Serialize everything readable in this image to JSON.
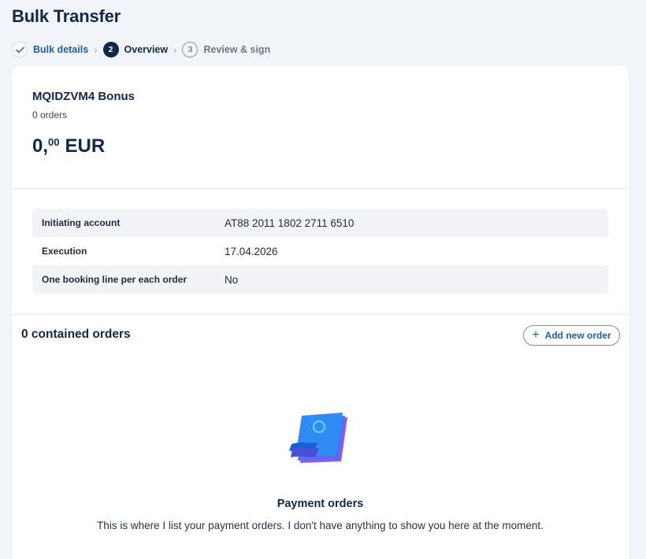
{
  "page": {
    "title": "Bulk Transfer"
  },
  "stepper": {
    "steps": [
      {
        "number": "",
        "label": "Bulk details",
        "state": "done"
      },
      {
        "number": "2",
        "label": "Overview",
        "state": "active"
      },
      {
        "number": "3",
        "label": "Review & sign",
        "state": "todo"
      }
    ]
  },
  "bulk": {
    "name": "MQIDZVM4 Bonus",
    "orders_count": "0 orders",
    "amount_int": "0,",
    "amount_dec": "00",
    "currency": "EUR"
  },
  "details": [
    {
      "label": "Initiating account",
      "value": "AT88 2011 1802 2711 6510"
    },
    {
      "label": "Execution",
      "value": "17.04.2026"
    },
    {
      "label": "One booking line per each order",
      "value": "No"
    }
  ],
  "orders": {
    "title": "0 contained orders",
    "add_button_label": "Add new order",
    "empty_title": "Payment orders",
    "empty_text": "This is where I list your payment orders. I don't have anything to show you here at the moment."
  },
  "icons": {
    "step_done": "check-icon",
    "add": "plus-icon",
    "empty": "payment-orders-illustration"
  },
  "colors": {
    "brand_navy": "#13274a",
    "link_blue": "#1f5fa6",
    "background": "#f1f4f8"
  }
}
